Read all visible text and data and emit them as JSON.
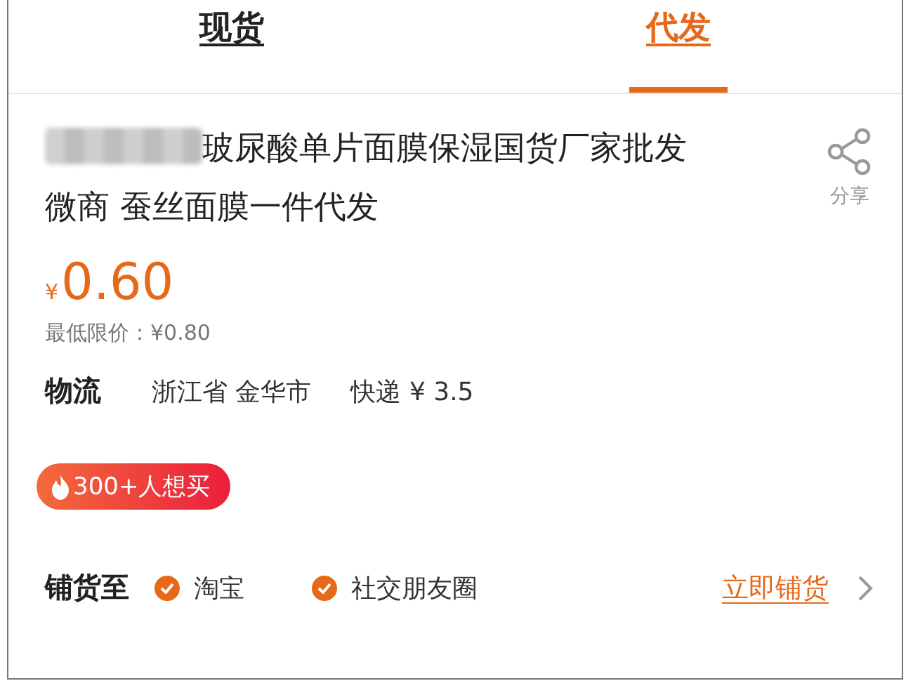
{
  "tabs": [
    {
      "label": "现货",
      "selected": false
    },
    {
      "label": "代发",
      "selected": true
    }
  ],
  "product": {
    "title": "玻尿酸单片面膜保湿国货厂家批发微商 蚕丝面膜一件代发",
    "share_label": "分享"
  },
  "price": {
    "currency": "¥",
    "amount": "0.60",
    "min_price": "最低限价：¥0.80"
  },
  "logistics": {
    "label": "物流",
    "origin": "浙江省 金华市",
    "shipping": "快递 ¥ 3.5"
  },
  "badge": {
    "text": "300+人想买"
  },
  "distribute": {
    "label": "铺货至",
    "options": [
      {
        "label": "淘宝",
        "checked": true
      },
      {
        "label": "社交朋友圈",
        "checked": true
      }
    ],
    "action": "立即铺货"
  }
}
